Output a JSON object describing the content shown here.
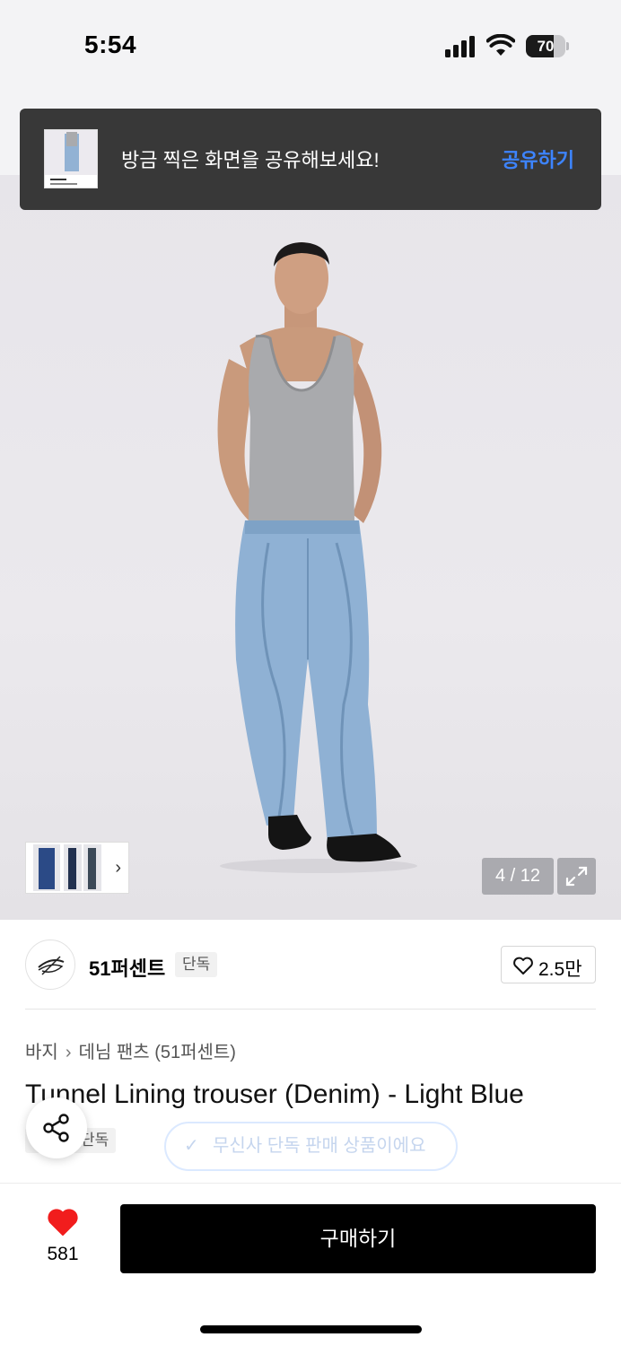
{
  "status_bar": {
    "time": "5:54",
    "battery": "70",
    "battery_level": 0.7
  },
  "toast": {
    "message": "방금 찍은 화면을 공유해보세요!",
    "action": "공유하기"
  },
  "gallery": {
    "pager": "4 / 12"
  },
  "brand": {
    "name": "51퍼센트",
    "badge": "단독",
    "likes": "2.5만"
  },
  "breadcrumb": {
    "category": "바지",
    "subcategory": "데님 팬츠 (51퍼센트)"
  },
  "product": {
    "title": "Tunnel Lining trouser (Denim) - Light Blue",
    "tag": "단독"
  },
  "exclusive_notice": "무신사 단독 판매 상품이에요",
  "bottom_bar": {
    "wish_count": "581",
    "buy_label": "구매하기"
  },
  "colors": {
    "accent_blue": "#3d84ff",
    "heart_red": "#f11d1d",
    "buy_button": "#000000"
  },
  "icons": [
    "signal-icon",
    "wifi-icon",
    "battery-icon",
    "chevron-right-icon",
    "expand-icon",
    "heart-outline-icon",
    "share-icon",
    "check-icon",
    "heart-filled-icon"
  ]
}
